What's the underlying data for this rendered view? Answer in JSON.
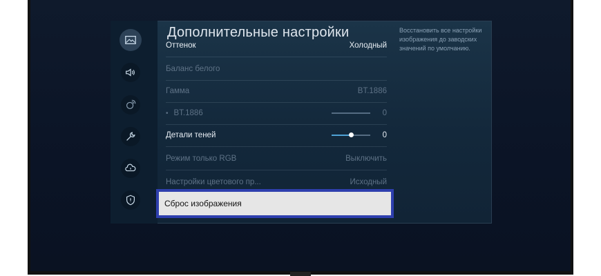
{
  "menu": {
    "title": "Дополнительные настройки",
    "rail_icons": [
      "picture-icon",
      "sound-icon",
      "broadcast-icon",
      "wrench-icon",
      "cloud-support-icon",
      "shield-icon"
    ],
    "items": [
      {
        "label": "Оттенок",
        "value": "Холодный"
      },
      {
        "label": "Баланс белого",
        "value": ""
      },
      {
        "label": "Гамма",
        "value": "BT.1886"
      },
      {
        "label": "BT.1886",
        "value": "0",
        "slider": 0.0
      },
      {
        "label": "Детали теней",
        "value": "0",
        "slider": 0.5
      },
      {
        "label": "Режим только RGB",
        "value": "Выключить"
      },
      {
        "label": "Настройки цветового пр...",
        "value": "Исходный"
      }
    ],
    "selected_item": "Сброс изображения",
    "help_text": "Восстановить все настройки изображения до заводских значений по умолчанию."
  },
  "colors": {
    "highlight_border": "#2e3fae",
    "slider_fill": "#4fa3d6"
  }
}
